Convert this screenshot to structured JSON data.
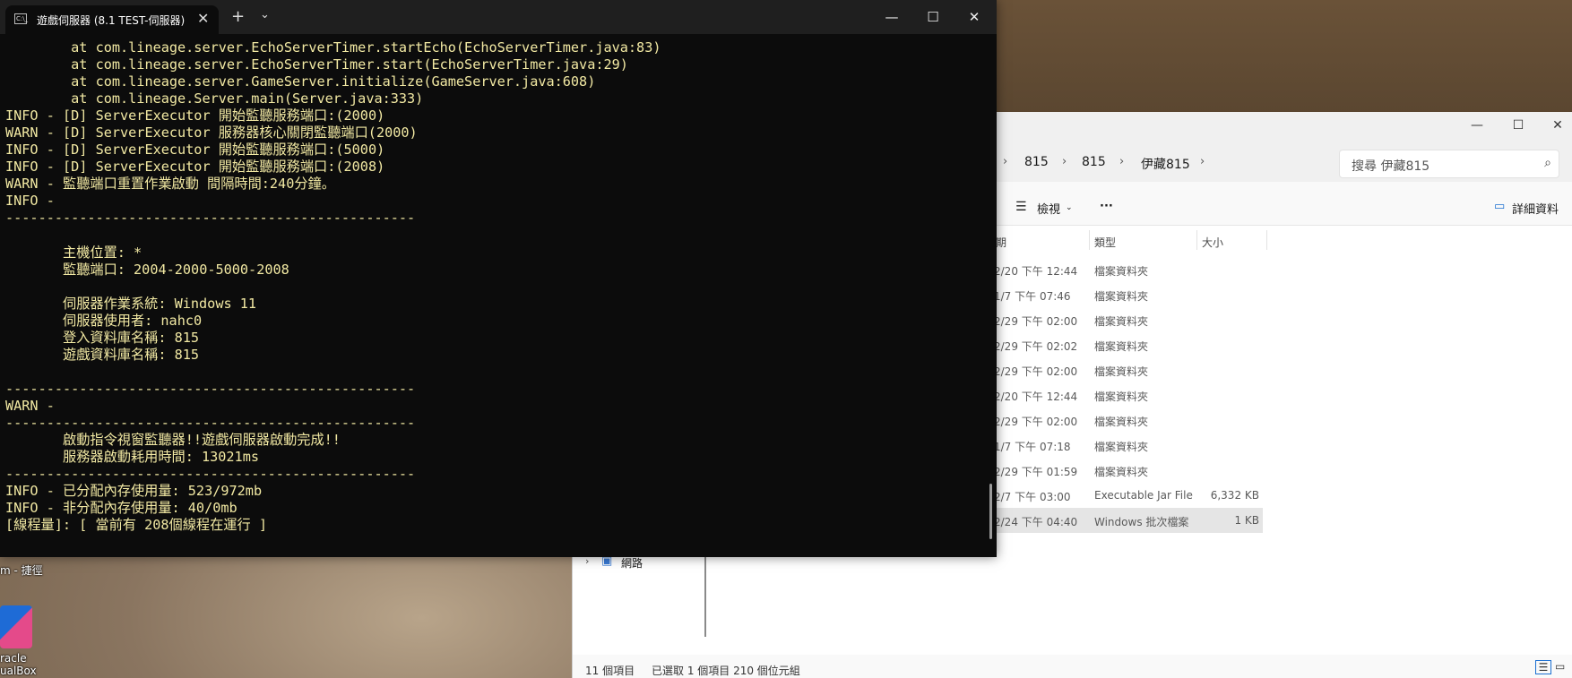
{
  "terminal": {
    "tab_title": "遊戲伺服器 (8.1 TEST-伺服器)",
    "tab_icon": "C:\\_",
    "close_tab": "✕",
    "new_tab": "+",
    "dropdown": "⌄",
    "minimize": "—",
    "maximize": "☐",
    "close": "✕",
    "lines": [
      "\tat com.lineage.server.EchoServerTimer.startEcho(EchoServerTimer.java:83)",
      "\tat com.lineage.server.EchoServerTimer.start(EchoServerTimer.java:29)",
      "\tat com.lineage.server.GameServer.initialize(GameServer.java:608)",
      "\tat com.lineage.Server.main(Server.java:333)",
      "INFO - [D] ServerExecutor 開始監聽服務端口:(2000)",
      "WARN - [D] ServerExecutor 服務器核心關閉監聽端口(2000)",
      "INFO - [D] ServerExecutor 開始監聽服務端口:(5000)",
      "INFO - [D] ServerExecutor 開始監聽服務端口:(2008)",
      "WARN - 監聽端口重置作業啟動 間隔時間:240分鐘。",
      "INFO -",
      "--------------------------------------------------",
      "",
      "       主機位置: *",
      "       監聽端口: 2004-2000-5000-2008",
      "",
      "       伺服器作業系統: Windows 11",
      "       伺服器使用者: nahc0",
      "       登入資料庫名稱: 815",
      "       遊戲資料庫名稱: 815",
      "",
      "--------------------------------------------------",
      "WARN -",
      "--------------------------------------------------",
      "       啟動指令視窗監聽器!!遊戲伺服器啟動完成!!",
      "       服務器啟動耗用時間: 13021ms",
      "--------------------------------------------------",
      "INFO - 已分配內存使用量: 523/972mb",
      "INFO - 非分配內存使用量: 40/0mb",
      "[線程量]: [ 當前有 208個線程在運行 ]"
    ]
  },
  "explorer": {
    "minimize": "—",
    "maximize": "☐",
    "close": "✕",
    "breadcrumbs": [
      "815",
      "815",
      "伊藏815"
    ],
    "crumb_sep": "›",
    "search_placeholder": "搜尋 伊藏815",
    "view_label": "檢視",
    "more_label": "···",
    "details_label": "詳細資料",
    "columns": [
      "期",
      "類型",
      "大小"
    ],
    "rows": [
      {
        "date": "2/20 下午 12:44",
        "type": "檔案資料夾",
        "size": ""
      },
      {
        "date": "1/7 下午 07:46",
        "type": "檔案資料夾",
        "size": ""
      },
      {
        "date": "2/29 下午 02:00",
        "type": "檔案資料夾",
        "size": ""
      },
      {
        "date": "2/29 下午 02:02",
        "type": "檔案資料夾",
        "size": ""
      },
      {
        "date": "2/29 下午 02:00",
        "type": "檔案資料夾",
        "size": ""
      },
      {
        "date": "2/20 下午 12:44",
        "type": "檔案資料夾",
        "size": ""
      },
      {
        "date": "2/29 下午 02:00",
        "type": "檔案資料夾",
        "size": ""
      },
      {
        "date": "1/7 下午 07:18",
        "type": "檔案資料夾",
        "size": ""
      },
      {
        "date": "2/29 下午 01:59",
        "type": "檔案資料夾",
        "size": ""
      },
      {
        "date": "2/7 下午 03:00",
        "type": "Executable Jar File",
        "size": "6,332 KB"
      },
      {
        "date": "2/24 下午 04:40",
        "type": "Windows 批次檔案",
        "size": "1 KB"
      }
    ],
    "nav_network": "網路",
    "status_count": "11 個項目",
    "status_selected": "已選取 1 個項目  210 個位元組"
  },
  "desktop": {
    "label_top": "m - 捷徑",
    "label_vbox_1": "racle",
    "label_vbox_2": "ualBox"
  }
}
